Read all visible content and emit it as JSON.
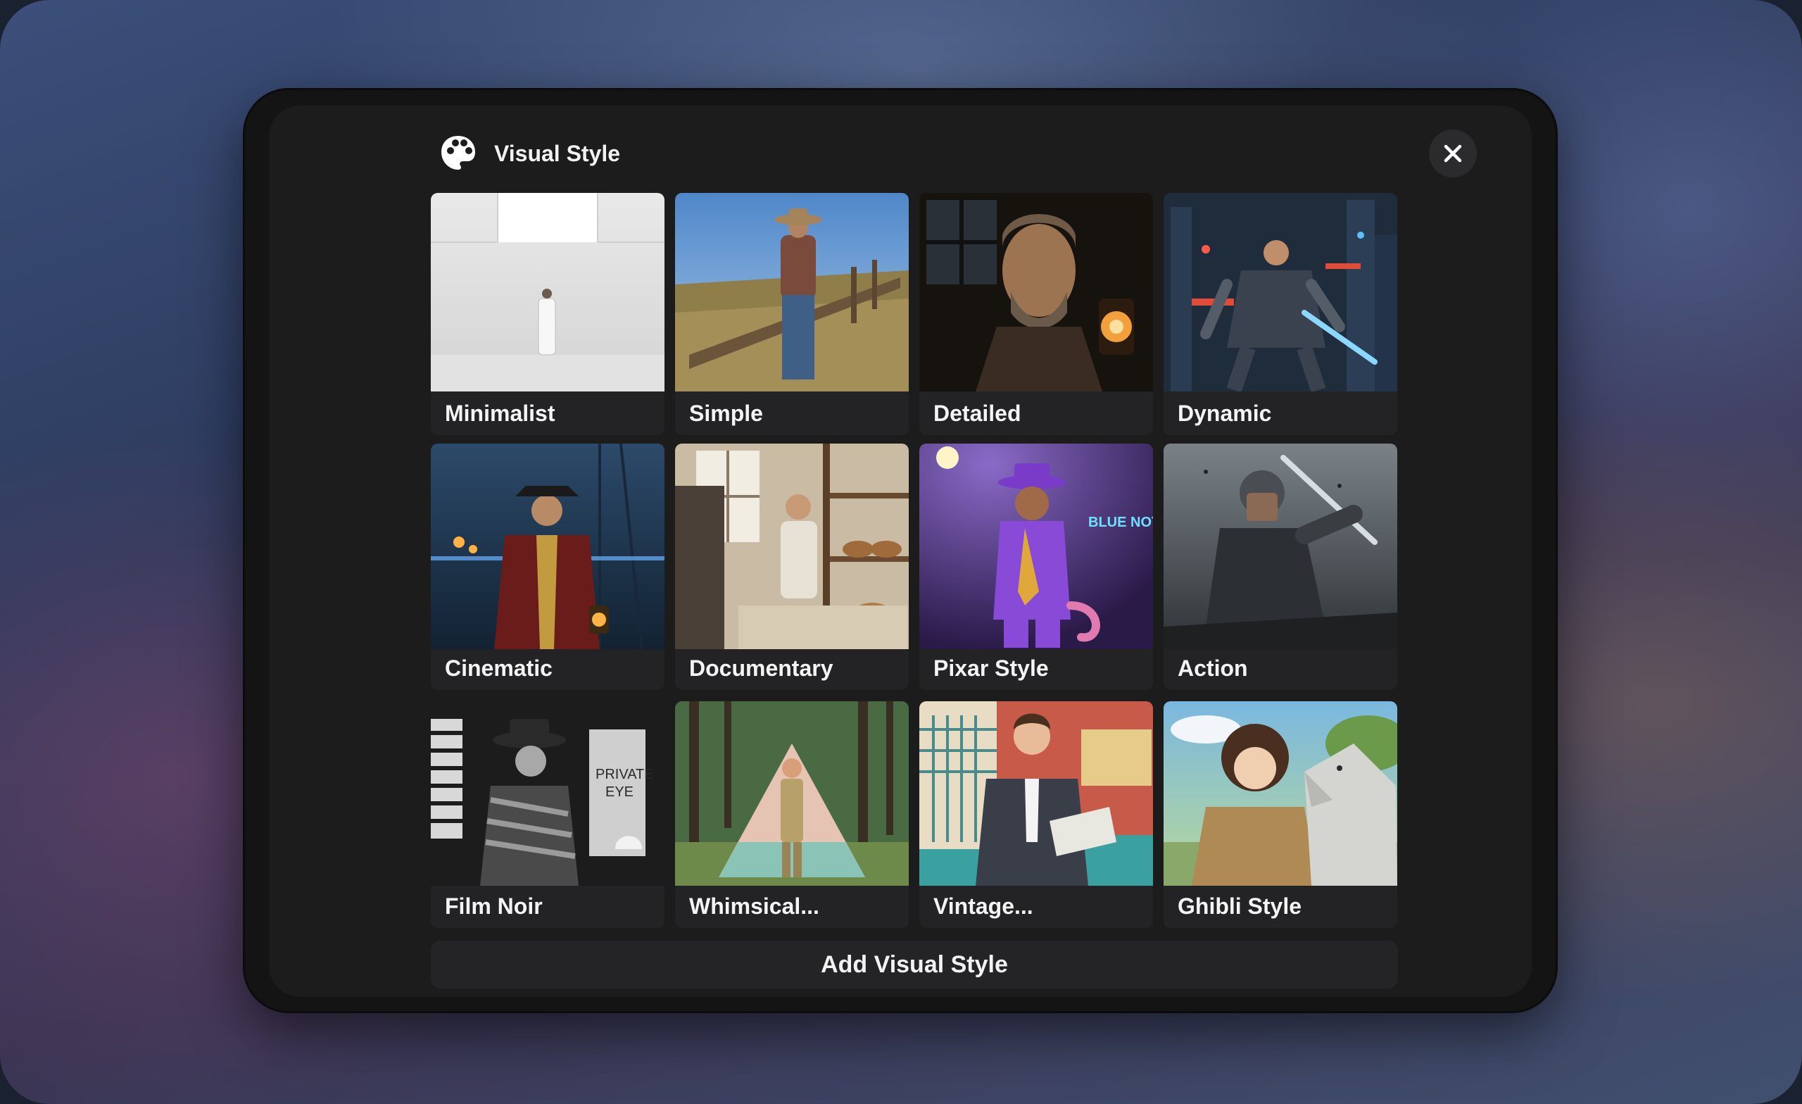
{
  "dialog": {
    "title": "Visual Style",
    "icon": "palette-icon",
    "close_icon": "close-icon"
  },
  "styles": [
    {
      "label": "Minimalist"
    },
    {
      "label": "Simple"
    },
    {
      "label": "Detailed"
    },
    {
      "label": "Dynamic"
    },
    {
      "label": "Cinematic"
    },
    {
      "label": "Documentary"
    },
    {
      "label": "Pixar Style"
    },
    {
      "label": "Action"
    },
    {
      "label": "Film Noir"
    },
    {
      "label": "Whimsical..."
    },
    {
      "label": "Vintage..."
    },
    {
      "label": "Ghibli Style"
    }
  ],
  "thumb_text": {
    "pixar_sign": "BLUE NOTE",
    "noir_sign_line1": "PRIVATE",
    "noir_sign_line2": "EYE"
  },
  "footer": {
    "add_label": "Add Visual Style"
  }
}
